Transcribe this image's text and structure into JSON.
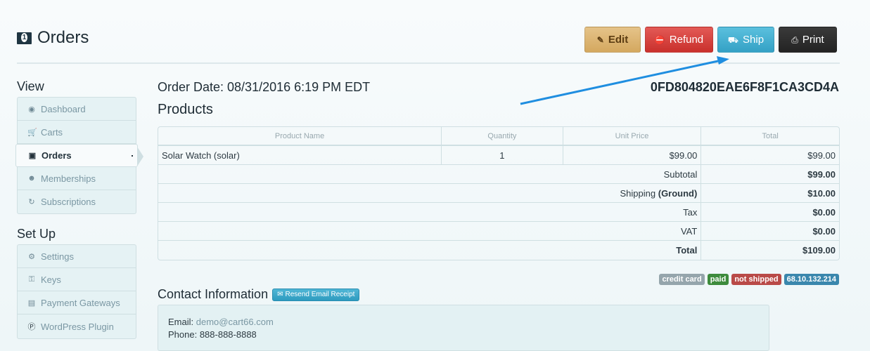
{
  "header": {
    "title": "Orders",
    "icon": "money-icon"
  },
  "toolbar": {
    "edit_label": "Edit",
    "refund_label": "Refund",
    "ship_label": "Ship",
    "print_label": "Print"
  },
  "sidebar": {
    "view_heading": "View",
    "view_items": [
      {
        "label": "Dashboard",
        "icon": "dashboard-icon"
      },
      {
        "label": "Carts",
        "icon": "cart-icon"
      },
      {
        "label": "Orders",
        "icon": "money-icon",
        "active": true
      },
      {
        "label": "Memberships",
        "icon": "users-icon"
      },
      {
        "label": "Subscriptions",
        "icon": "refresh-icon"
      }
    ],
    "setup_heading": "Set Up",
    "setup_items": [
      {
        "label": "Settings",
        "icon": "gear-icon"
      },
      {
        "label": "Keys",
        "icon": "key-icon"
      },
      {
        "label": "Payment Gateways",
        "icon": "credit-card-icon"
      },
      {
        "label": "WordPress Plugin",
        "icon": "wordpress-icon"
      }
    ]
  },
  "order": {
    "date_label": "Order Date: 08/31/2016 6:19 PM EDT",
    "id": "0FD804820EAE6F8F1CA3CD4A",
    "products_heading": "Products",
    "columns": [
      "Product Name",
      "Quantity",
      "Unit Price",
      "Total"
    ],
    "items": [
      {
        "name": "Solar Watch (solar)",
        "quantity": "1",
        "unit_price": "$99.00",
        "total": "$99.00"
      }
    ],
    "summary": {
      "subtotal_label": "Subtotal",
      "subtotal": "$99.00",
      "shipping_label": "Shipping",
      "shipping_method": "(Ground)",
      "shipping": "$10.00",
      "tax_label": "Tax",
      "tax": "$0.00",
      "vat_label": "VAT",
      "vat": "$0.00",
      "total_label": "Total",
      "total": "$109.00"
    },
    "badges": [
      {
        "label": "credit card",
        "color": "#95a5ac"
      },
      {
        "label": "paid",
        "color": "#3d8b3d"
      },
      {
        "label": "not shipped",
        "color": "#b94a48"
      },
      {
        "label": "68.10.132.214",
        "color": "#3a87ad"
      }
    ]
  },
  "contact": {
    "heading": "Contact Information",
    "resend_label": "Resend Email Receipt",
    "email_label": "Email:",
    "email": "demo@cart66.com",
    "phone_label": "Phone:",
    "phone": "888-888-8888"
  },
  "annotation": {
    "arrow_color": "#1f8ee0",
    "target": "Ship"
  }
}
